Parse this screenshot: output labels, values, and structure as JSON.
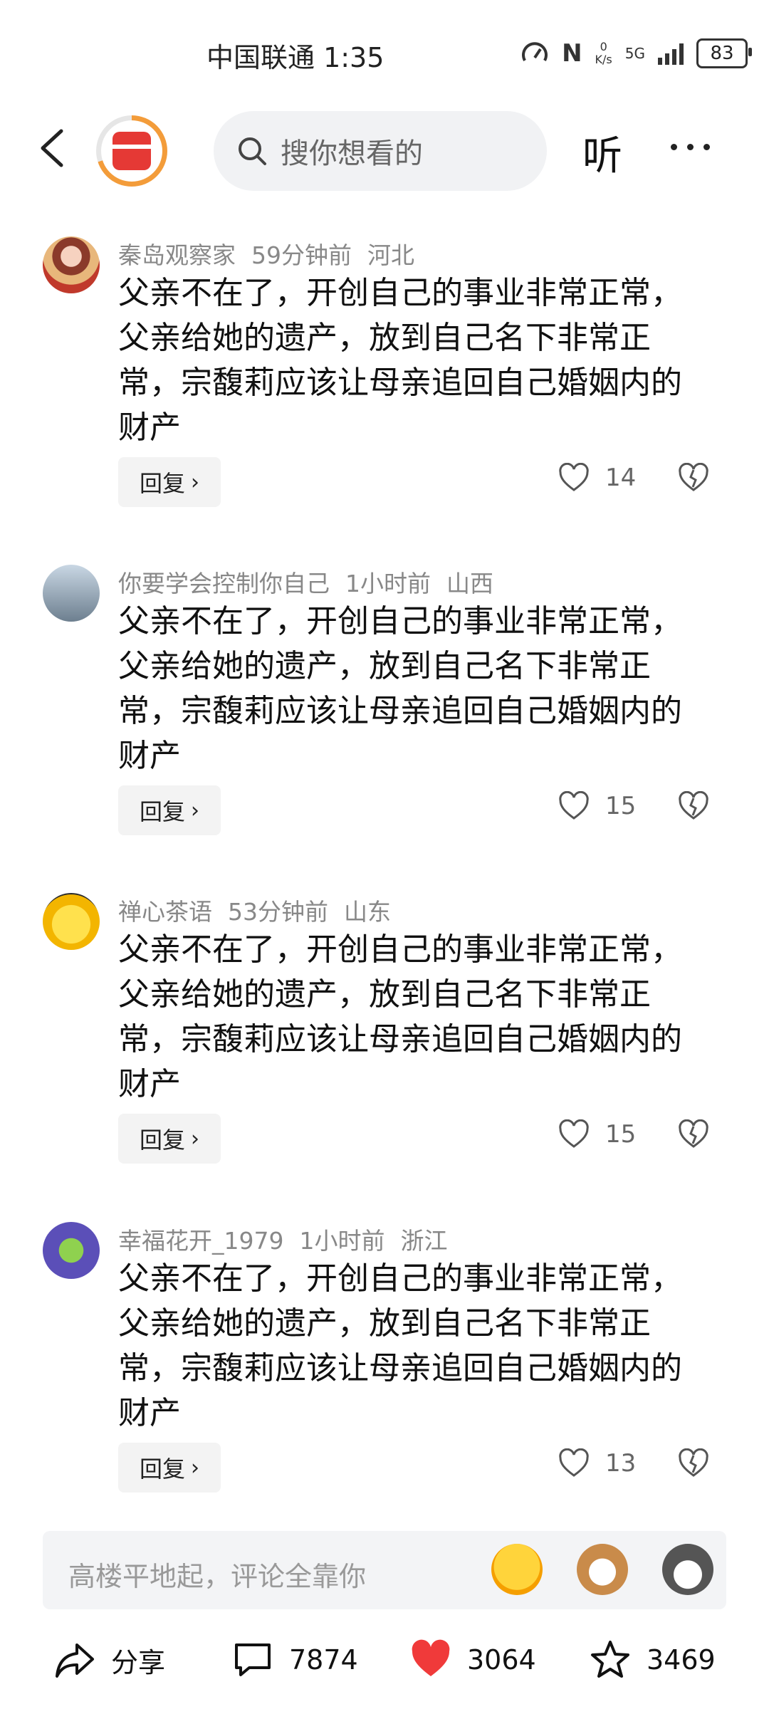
{
  "status_bar": {
    "carrier_time": "中国联通 1:35",
    "net_speed_value": "0",
    "net_speed_unit": "K/s",
    "network": "5G",
    "battery": "83"
  },
  "header": {
    "search_placeholder": "搜你想看的",
    "listen_label": "听"
  },
  "comments": [
    {
      "user": "秦岛观察家",
      "time": "59分钟前",
      "location": "河北",
      "text": "父亲不在了，开创自己的事业非常正常，父亲给她的遗产，放到自己名下非常正常，宗馥莉应该让母亲追回自己婚姻内的财产",
      "reply_label": "回复",
      "likes": "14"
    },
    {
      "user": "你要学会控制你自己",
      "time": "1小时前",
      "location": "山西",
      "text": "父亲不在了，开创自己的事业非常正常，父亲给她的遗产，放到自己名下非常正常，宗馥莉应该让母亲追回自己婚姻内的财产",
      "reply_label": "回复",
      "likes": "15"
    },
    {
      "user": "禅心茶语",
      "time": "53分钟前",
      "location": "山东",
      "text": "父亲不在了，开创自己的事业非常正常，父亲给她的遗产，放到自己名下非常正常，宗馥莉应该让母亲追回自己婚姻内的财产",
      "reply_label": "回复",
      "likes": "15"
    },
    {
      "user": "幸福花开_1979",
      "time": "1小时前",
      "location": "浙江",
      "text": "父亲不在了，开创自己的事业非常正常，父亲给她的遗产，放到自己名下非常正常，宗馥莉应该让母亲追回自己婚姻内的财产",
      "reply_label": "回复",
      "likes": "13"
    }
  ],
  "input_bar": {
    "placeholder": "高楼平地起，评论全靠你"
  },
  "bottom_bar": {
    "share_label": "分享",
    "comment_count": "7874",
    "like_count": "3064",
    "favorite_count": "3469"
  },
  "colors": {
    "like_red": "#f03a3a",
    "meta_gray": "#888888",
    "accent_orange": "#f39c3a"
  }
}
